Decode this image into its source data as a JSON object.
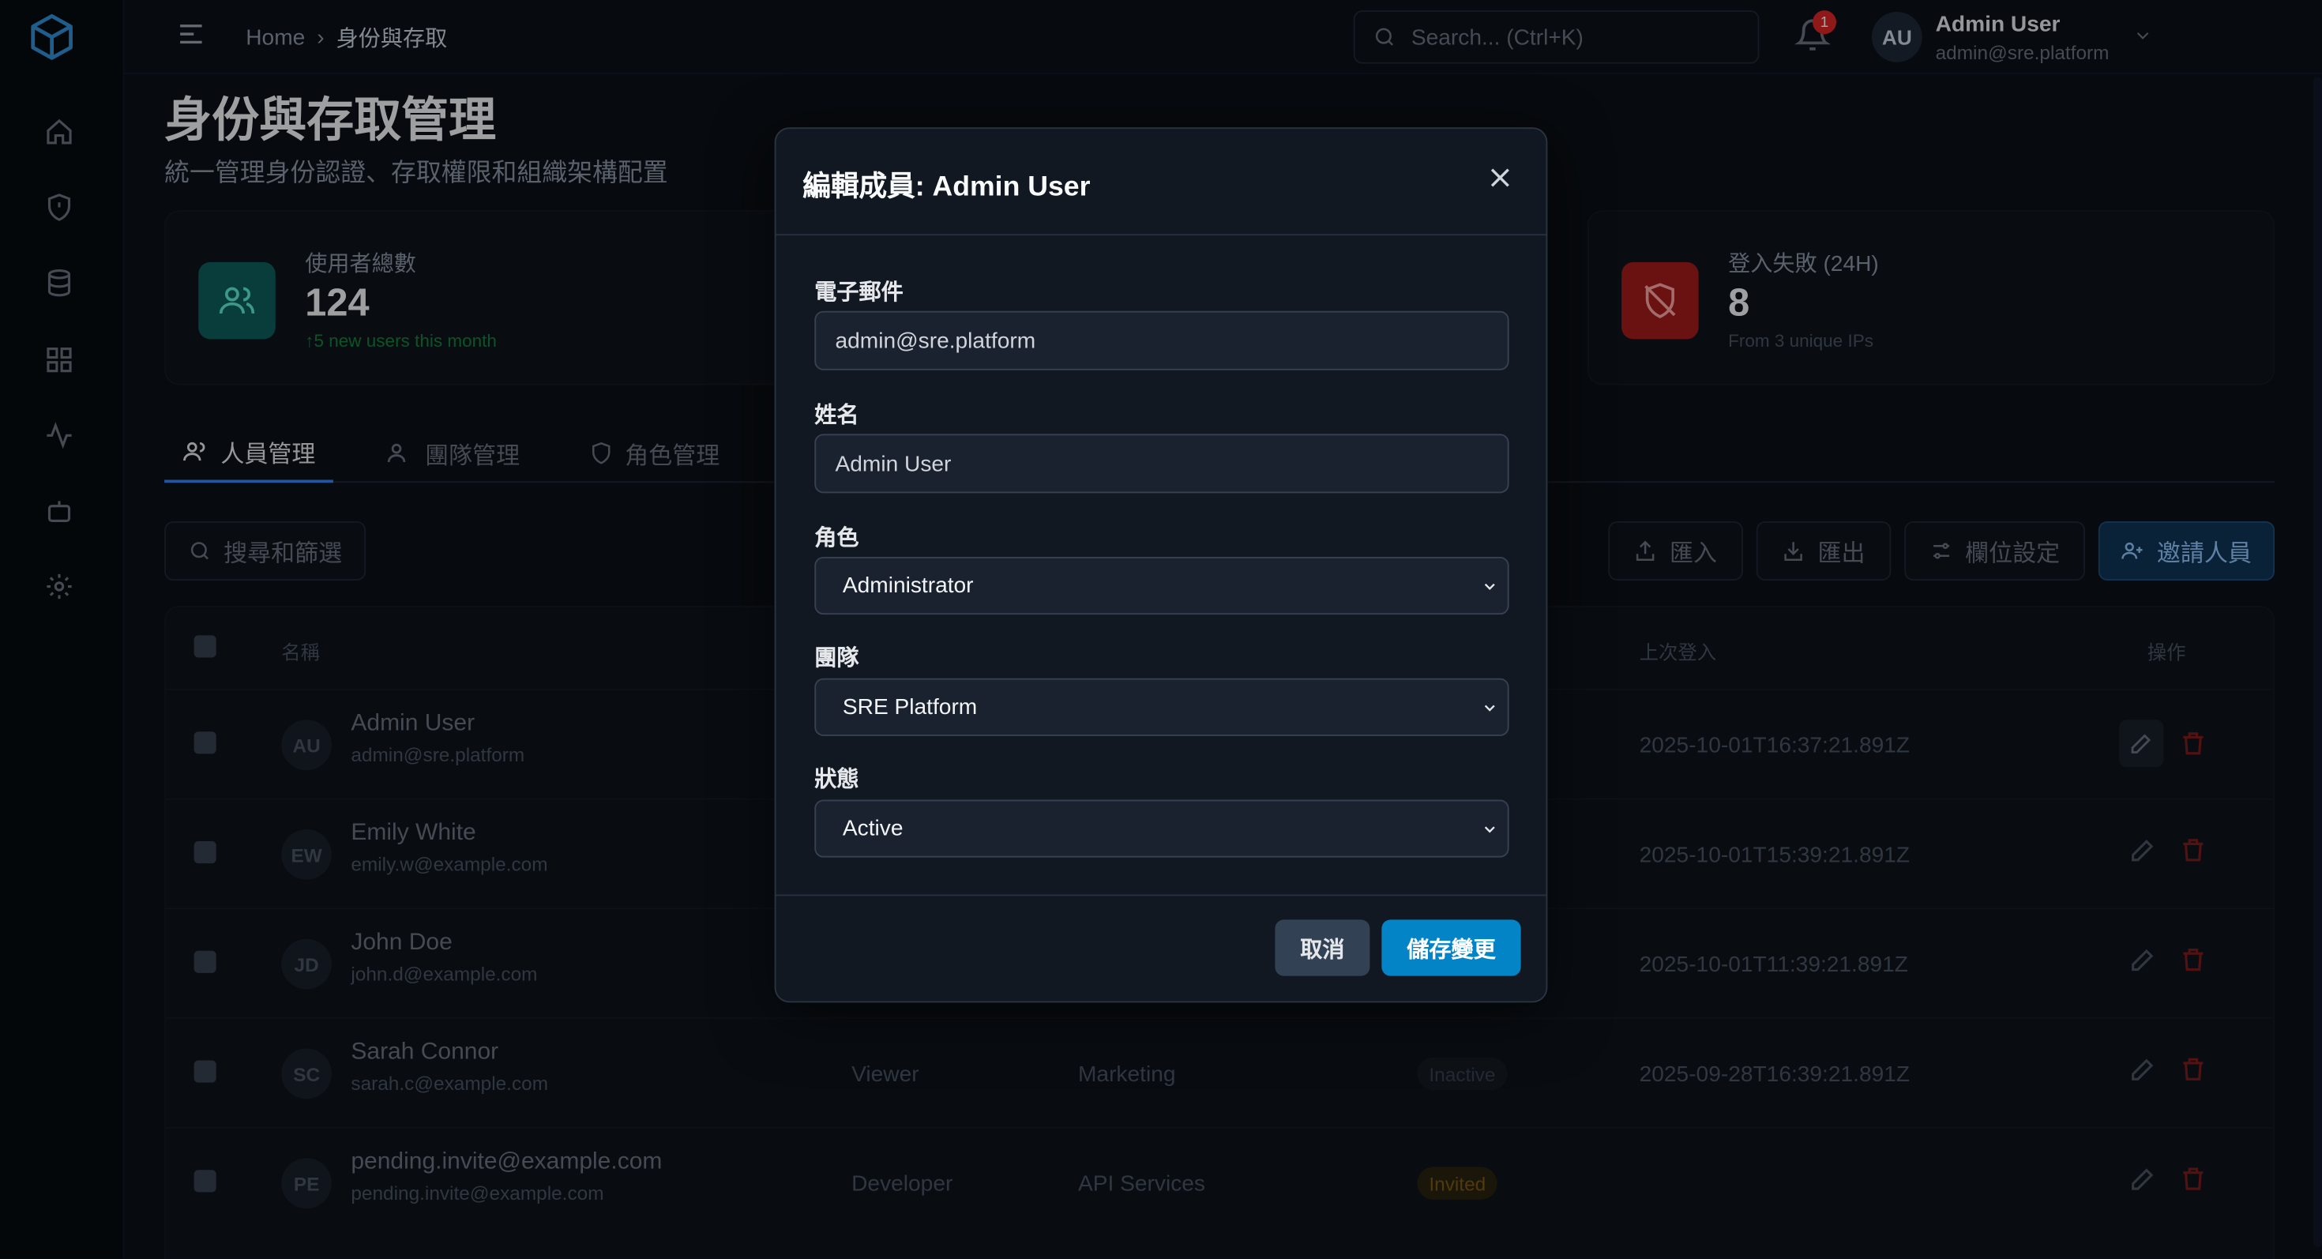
{
  "breadcrumb": {
    "home": "Home",
    "current": "身份與存取"
  },
  "search": {
    "placeholder": "Search... (Ctrl+K)"
  },
  "notifications": {
    "count": "1"
  },
  "user": {
    "initials": "AU",
    "name": "Admin User",
    "email": "admin@sre.platform"
  },
  "page": {
    "title": "身份與存取管理",
    "subtitle": "統一管理身份認證、存取權限和組織架構配置"
  },
  "stats": [
    {
      "label": "使用者總數",
      "value": "124",
      "note": "↑5 new users this month",
      "icon": "users-icon",
      "color": "#0f766e"
    },
    {
      "label": "登入失敗 (24H)",
      "value": "8",
      "note": "From 3 unique IPs",
      "icon": "shield-off-icon",
      "color": "#b91c1c"
    }
  ],
  "tabs": [
    {
      "label": "人員管理",
      "icon": "users-icon",
      "active": true
    },
    {
      "label": "團隊管理",
      "icon": "team-icon"
    },
    {
      "label": "角色管理",
      "icon": "shield-icon"
    }
  ],
  "toolbar": {
    "filter": "搜尋和篩選",
    "import": "匯入",
    "export": "匯出",
    "columns": "欄位設定",
    "invite": "邀請人員"
  },
  "table": {
    "headers": {
      "name": "名稱",
      "last_login": "上次登入",
      "actions": "操作"
    },
    "rows": [
      {
        "initials": "AU",
        "name": "Admin User",
        "email": "admin@sre.platform",
        "role": "",
        "team": "",
        "status": "",
        "last_login": "2025-10-01T16:37:21.891Z"
      },
      {
        "initials": "EW",
        "name": "Emily White",
        "email": "emily.w@example.com",
        "role": "",
        "team": "",
        "status": "",
        "last_login": "2025-10-01T15:39:21.891Z"
      },
      {
        "initials": "JD",
        "name": "John Doe",
        "email": "john.d@example.com",
        "role": "",
        "team": "",
        "status": "",
        "last_login": "2025-10-01T11:39:21.891Z"
      },
      {
        "initials": "SC",
        "name": "Sarah Connor",
        "email": "sarah.c@example.com",
        "role": "Viewer",
        "team": "Marketing",
        "status": "Inactive",
        "last_login": "2025-09-28T16:39:21.891Z"
      },
      {
        "initials": "PE",
        "name": "pending.invite@example.com",
        "email": "pending.invite@example.com",
        "role": "Developer",
        "team": "API Services",
        "status": "Invited",
        "last_login": ""
      }
    ]
  },
  "modal": {
    "title": "編輯成員: Admin User",
    "email_label": "電子郵件",
    "email_value": "admin@sre.platform",
    "name_label": "姓名",
    "name_value": "Admin User",
    "role_label": "角色",
    "role_value": "Administrator",
    "team_label": "團隊",
    "team_value": "SRE Platform",
    "status_label": "狀態",
    "status_value": "Active",
    "cancel": "取消",
    "save": "儲存變更"
  }
}
